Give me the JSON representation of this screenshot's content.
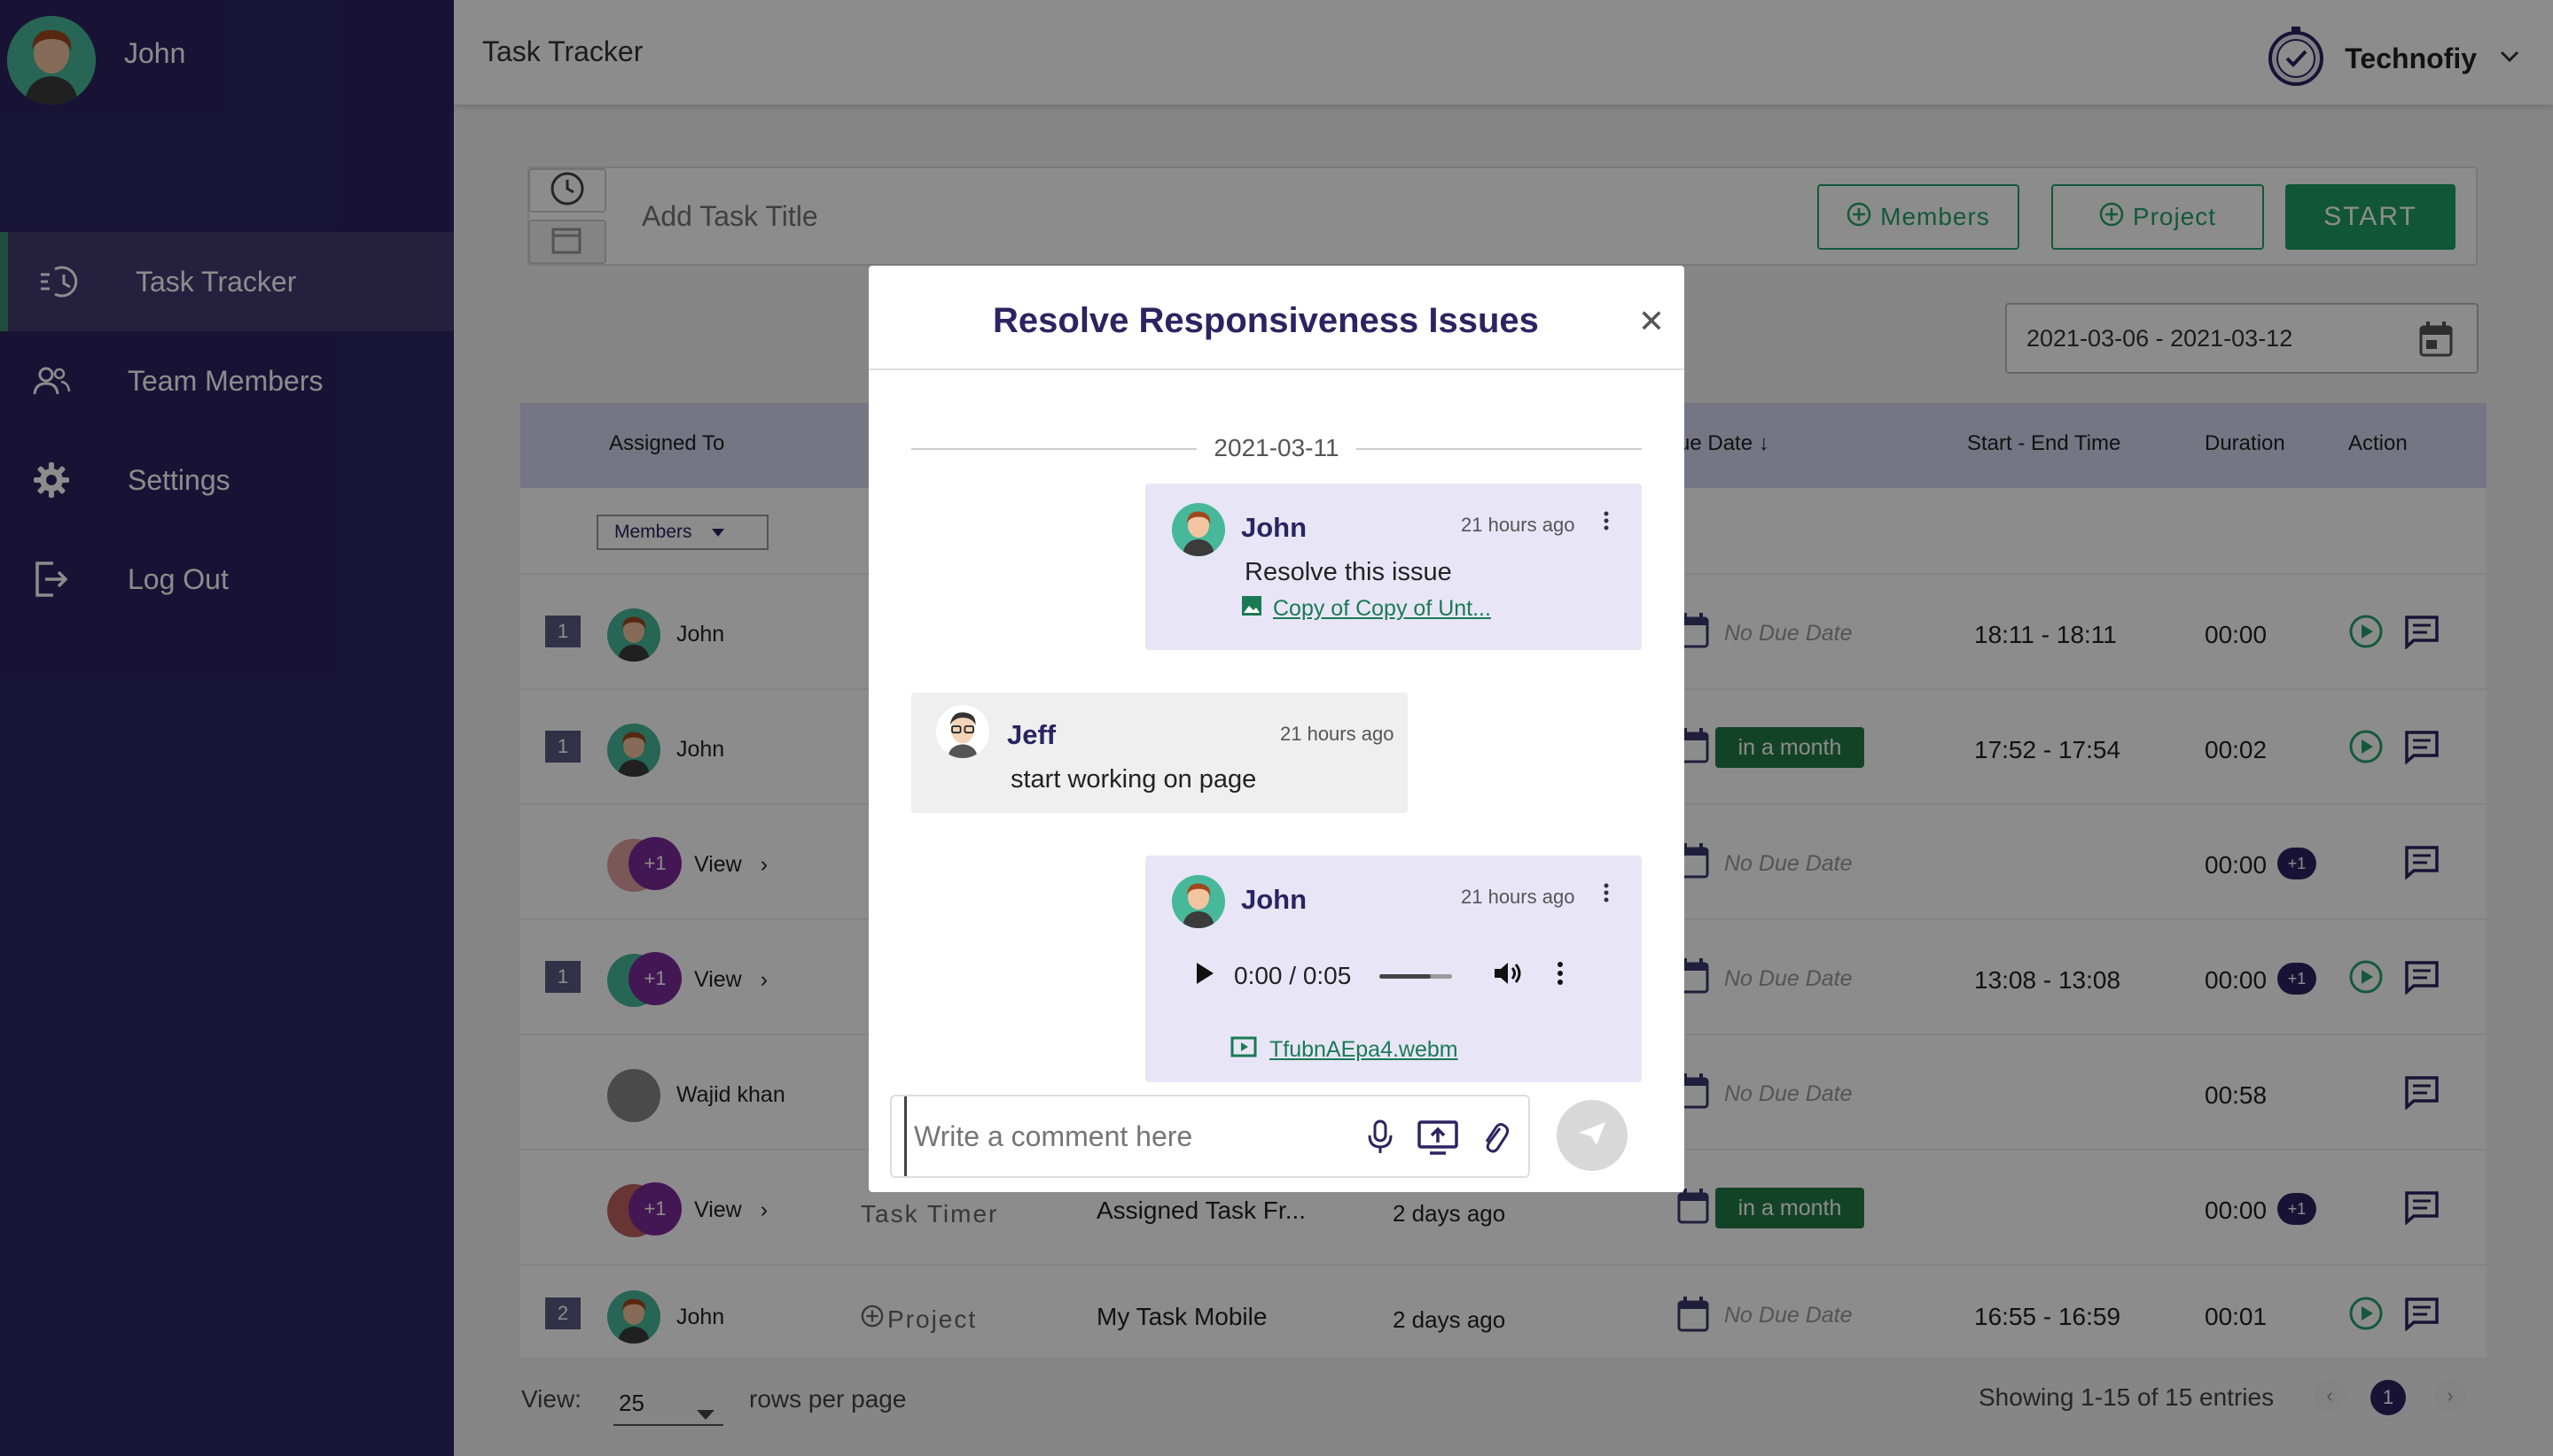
{
  "sidebar": {
    "username": "John",
    "items": [
      {
        "label": "Task Tracker",
        "icon": "task-history-icon"
      },
      {
        "label": "Team Members",
        "icon": "team-icon"
      },
      {
        "label": "Settings",
        "icon": "gear-icon"
      },
      {
        "label": "Log Out",
        "icon": "logout-icon"
      }
    ]
  },
  "header": {
    "title": "Task Tracker",
    "org_name": "Technofiy"
  },
  "taskbar": {
    "placeholder": "Add Task Title",
    "members_label": "Members",
    "project_label": "Project",
    "start_label": "START"
  },
  "date_range": "2021-03-06 - 2021-03-12",
  "table": {
    "headers": {
      "assigned": "Assigned To",
      "due": "ue Date",
      "start_end": "Start - End Time",
      "duration": "Duration",
      "action": "Action"
    },
    "members_filter": "Members",
    "rows": [
      {
        "num": "1",
        "name": "John",
        "due": "No Due Date",
        "start_end": "18:11 - 18:11",
        "duration": "00:00"
      },
      {
        "num": "1",
        "name": "John",
        "due": "in a month",
        "start_end": "17:52 - 17:54",
        "duration": "00:02"
      },
      {
        "num": "",
        "name": "View",
        "plus": "+1",
        "due": "No Due Date",
        "start_end": "",
        "duration": "00:00",
        "dur_badge": "+1"
      },
      {
        "num": "1",
        "name": "View",
        "plus": "+1",
        "due": "No Due Date",
        "start_end": "13:08 - 13:08",
        "duration": "00:00",
        "dur_badge": "+1"
      },
      {
        "num": "",
        "name": "Wajid khan",
        "due": "No Due Date",
        "start_end": "",
        "duration": "00:58"
      },
      {
        "num": "",
        "name": "View",
        "plus": "+1",
        "project": "Task Timer",
        "task": "Assigned Task Fr...",
        "created": "2 days ago",
        "due": "in a month",
        "start_end": "",
        "duration": "00:00",
        "dur_badge": "+1"
      },
      {
        "num": "2",
        "name": "John",
        "project": "Project",
        "task": "My Task Mobile",
        "created": "2 days ago",
        "due": "No Due Date",
        "start_end": "16:55 - 16:59",
        "duration": "00:01"
      }
    ]
  },
  "footer": {
    "view_label": "View:",
    "rows_per_page": "25",
    "rows_suffix": "rows per page",
    "showing": "Showing 1-15 of 15 entries",
    "page": "1"
  },
  "modal": {
    "title": "Resolve Responsiveness Issues",
    "date": "2021-03-11",
    "messages": [
      {
        "author": "John",
        "time": "21 hours ago",
        "text": "Resolve this issue",
        "attachment": "Copy of Copy of Unt..."
      },
      {
        "author": "Jeff",
        "time": "21 hours ago",
        "text": "start working on page"
      },
      {
        "author": "John",
        "time": "21 hours ago",
        "audio_time": "0:00 / 0:05",
        "attachment": "TfubnAEpa4.webm"
      }
    ],
    "composer_placeholder": "Write a comment here"
  },
  "colors": {
    "sidebar": "#2c2461",
    "accent_green": "#1f9d63",
    "modal_title": "#2c2461",
    "badge_green": "#237a47"
  }
}
